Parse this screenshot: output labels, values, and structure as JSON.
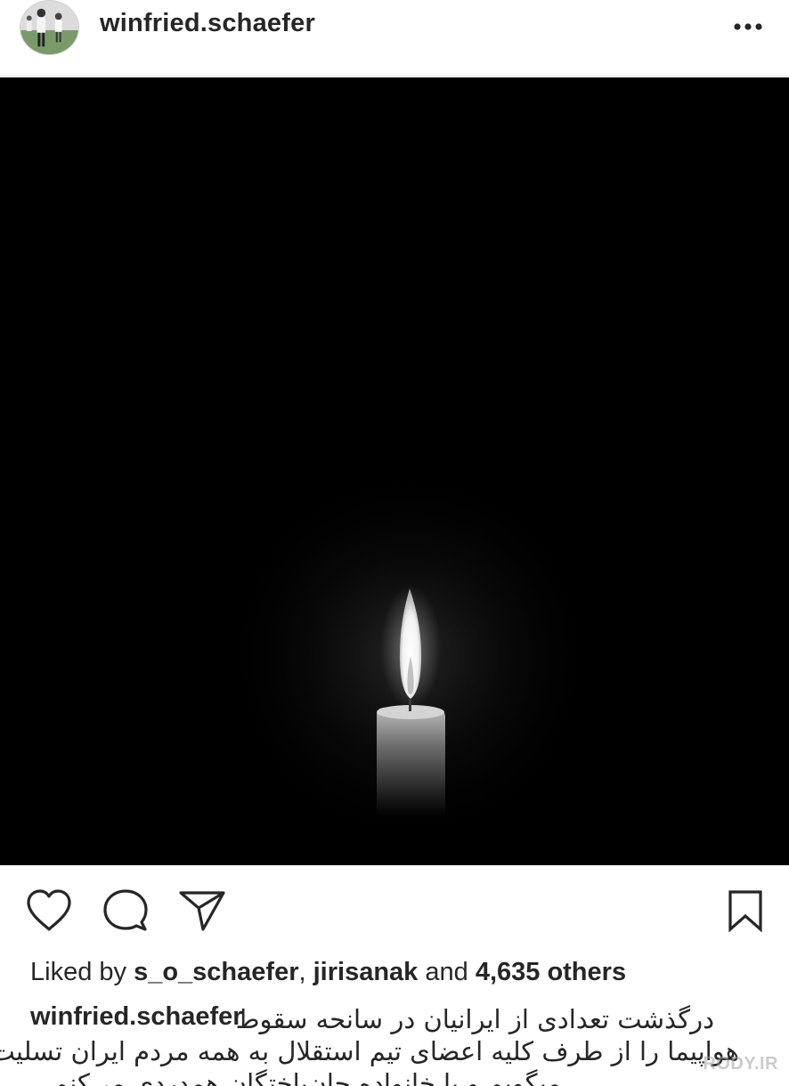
{
  "header": {
    "username": "winfried.schaefer",
    "avatar_icon": "profile-photo",
    "more_icon": "ellipsis-icon"
  },
  "photo": {
    "subject": "candle-flame",
    "background_color": "#000000"
  },
  "actions": {
    "like_icon": "heart-icon",
    "comment_icon": "comment-bubble-icon",
    "share_icon": "paper-plane-icon",
    "save_icon": "bookmark-icon"
  },
  "likes": {
    "prefix": "Liked by",
    "user1": "s_o_schaefer",
    "separator": ",",
    "user2": "jirisanak",
    "conjunction": "and",
    "others": "4,635 others"
  },
  "caption": {
    "username": "winfried.schaefer",
    "line1": "درگذشت تعدادی از ایرانیان در سانحه سقوط",
    "line2": "هواپیما را از طرف کلیه اعضای تیم استقلال به همه مردم ایران تسلیت",
    "line3": "میگویم و با خانواده جان‌باختگان همدردی می‌کنم"
  },
  "watermark": {
    "text": "RODY.IR"
  }
}
